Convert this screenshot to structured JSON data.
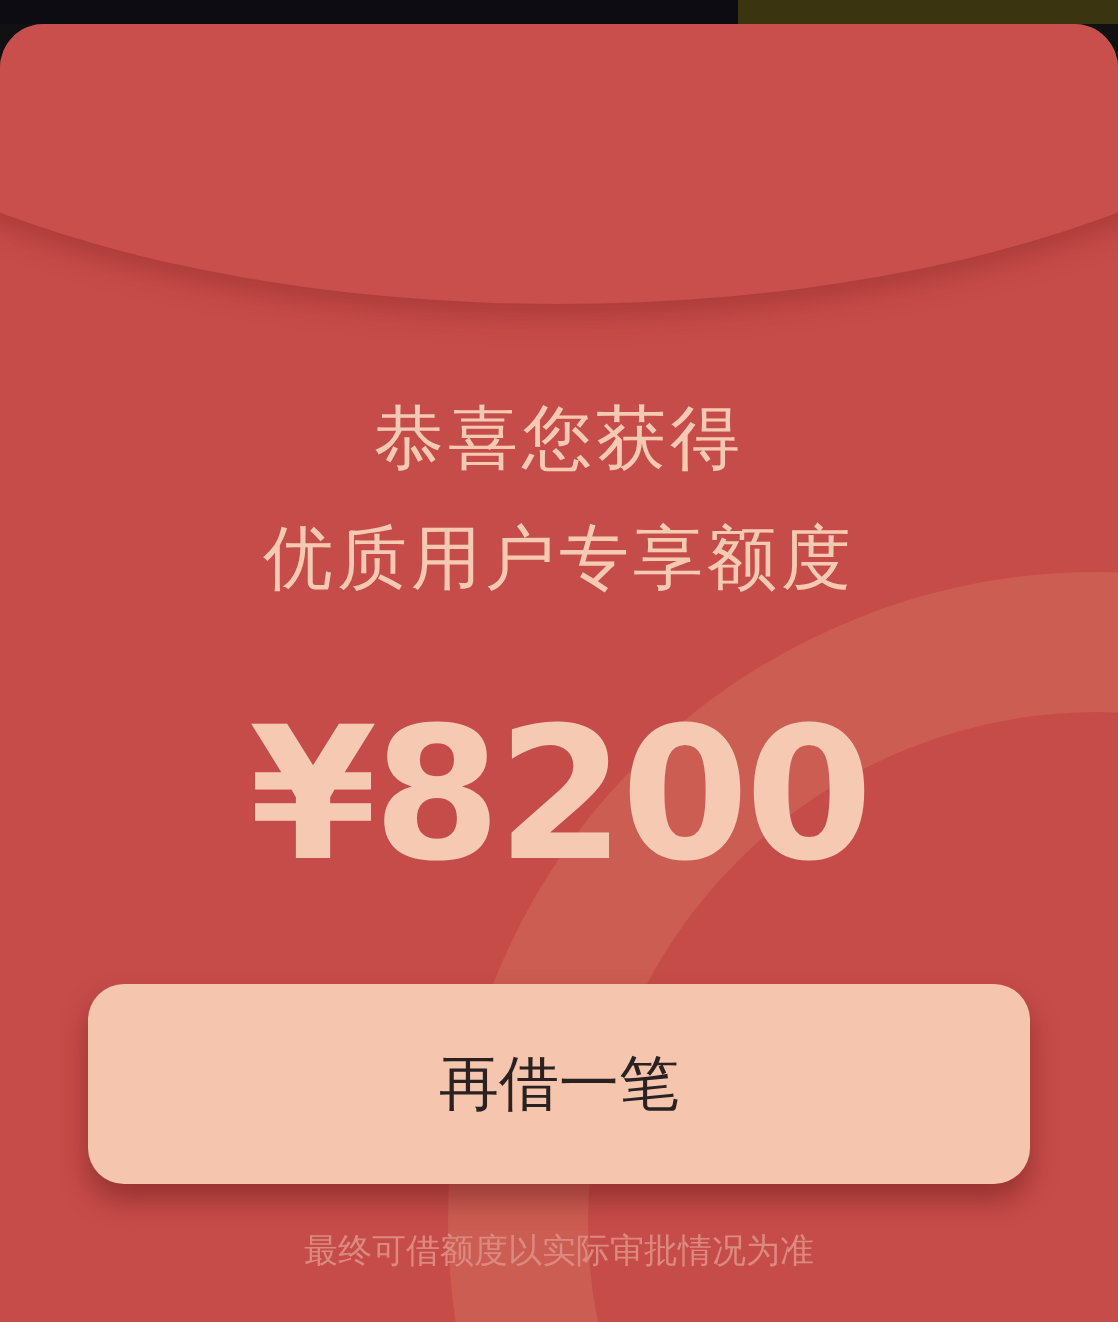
{
  "envelope": {
    "headline": [
      "恭喜您获得",
      "优质用户专享额度"
    ],
    "amount": "¥8200",
    "button": "再借一笔",
    "footnote": "最终可借额度以实际审批情况为准"
  }
}
